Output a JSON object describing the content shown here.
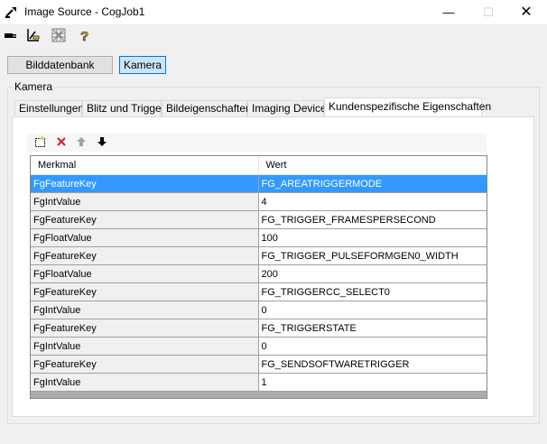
{
  "window": {
    "title": "Image Source - CogJob1",
    "minimize_glyph": "—",
    "maximize_glyph": "☐",
    "close_glyph": "✕"
  },
  "toolbar": {
    "icons": [
      "plug-icon",
      "setup-icon",
      "grid-icon",
      "help-icon"
    ]
  },
  "source_buttons": {
    "database_label": "Bilddatenbank",
    "camera_label": "Kamera",
    "selected": "camera"
  },
  "group": {
    "label": "Kamera"
  },
  "tabs": [
    {
      "label": "Einstellungen"
    },
    {
      "label": "Blitz und Trigger"
    },
    {
      "label": "Bildeigenschaften"
    },
    {
      "label": "Imaging Device"
    },
    {
      "label": "Kundenspezifische Eigenschaften"
    }
  ],
  "active_tab": 4,
  "grid_toolbar": {
    "icons": [
      "new-row-icon",
      "delete-icon",
      "move-up-icon",
      "move-down-icon"
    ]
  },
  "table": {
    "columns": [
      "Merkmal",
      "Wert"
    ],
    "selected_row": 0,
    "rows": [
      {
        "key": "FgFeatureKey",
        "value": "FG_AREATRIGGERMODE"
      },
      {
        "key": "FgIntValue",
        "value": "4"
      },
      {
        "key": "FgFeatureKey",
        "value": "FG_TRIGGER_FRAMESPERSECOND"
      },
      {
        "key": "FgFloatValue",
        "value": "100"
      },
      {
        "key": "FgFeatureKey",
        "value": "FG_TRIGGER_PULSEFORMGEN0_WIDTH"
      },
      {
        "key": "FgFloatValue",
        "value": "200"
      },
      {
        "key": "FgFeatureKey",
        "value": "FG_TRIGGERCC_SELECT0"
      },
      {
        "key": "FgIntValue",
        "value": "0"
      },
      {
        "key": "FgFeatureKey",
        "value": "FG_TRIGGERSTATE"
      },
      {
        "key": "FgIntValue",
        "value": "0"
      },
      {
        "key": "FgFeatureKey",
        "value": "FG_SENDSOFTWARETRIGGER"
      },
      {
        "key": "FgIntValue",
        "value": "1"
      }
    ]
  },
  "colors": {
    "selection": "#3399ff",
    "selected_button": "#cce4f7",
    "selected_button_border": "#0078d7"
  }
}
